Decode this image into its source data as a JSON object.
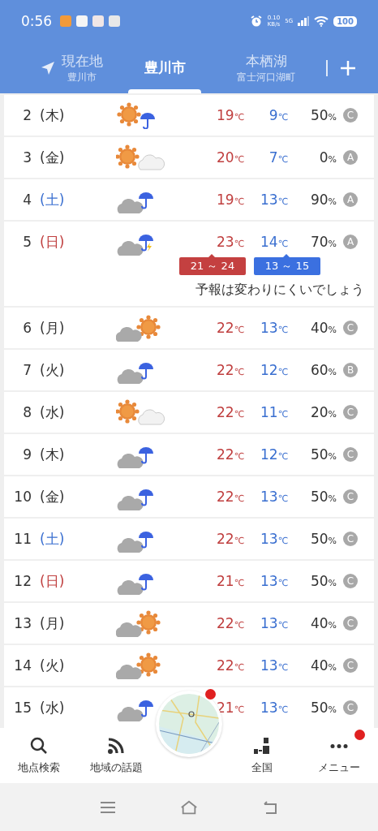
{
  "status_bar": {
    "time": "0:56",
    "net_speed": "0.10",
    "net_unit": "KB/s",
    "network": "5G",
    "battery": "100"
  },
  "tabs": [
    {
      "kind": "location",
      "label": "現在地",
      "sublabel": "豊川市",
      "selected": false
    },
    {
      "kind": "place",
      "label": "豊川市",
      "selected": true
    },
    {
      "kind": "place",
      "label": "本栖湖",
      "sublabel": "富士河口湖町",
      "selected": false
    }
  ],
  "days": [
    {
      "date": "2",
      "weekday": "(木)",
      "color": "#333333",
      "kind": "sun-rain",
      "high": "19",
      "low": "9",
      "unit": "℃",
      "pop": "50",
      "pop_unit": "%",
      "rank": "C"
    },
    {
      "date": "3",
      "weekday": "(金)",
      "color": "#333333",
      "kind": "sun-cloud",
      "high": "20",
      "low": "7",
      "unit": "℃",
      "pop": "0",
      "pop_unit": "%",
      "rank": "A"
    },
    {
      "date": "4",
      "weekday": "(土)",
      "color": "#3a6fd0",
      "kind": "cloud-rain",
      "high": "19",
      "low": "13",
      "unit": "℃",
      "pop": "90",
      "pop_unit": "%",
      "rank": "A"
    },
    {
      "date": "5",
      "weekday": "(日)",
      "color": "#c04040",
      "kind": "cloud-thunder-rain",
      "high": "23",
      "low": "14",
      "unit": "℃",
      "pop": "70",
      "pop_unit": "%",
      "rank": "A",
      "high_range": "21 ～ 24",
      "low_range": "13 ～ 15",
      "note": "予報は変わりにくいでしょう"
    },
    {
      "date": "6",
      "weekday": "(月)",
      "color": "#333333",
      "kind": "cloud-sun",
      "high": "22",
      "low": "13",
      "unit": "℃",
      "pop": "40",
      "pop_unit": "%",
      "rank": "C"
    },
    {
      "date": "7",
      "weekday": "(火)",
      "color": "#333333",
      "kind": "cloud-rain",
      "high": "22",
      "low": "12",
      "unit": "℃",
      "pop": "60",
      "pop_unit": "%",
      "rank": "B"
    },
    {
      "date": "8",
      "weekday": "(水)",
      "color": "#333333",
      "kind": "sun-cloud",
      "high": "22",
      "low": "11",
      "unit": "℃",
      "pop": "20",
      "pop_unit": "%",
      "rank": "C"
    },
    {
      "date": "9",
      "weekday": "(木)",
      "color": "#333333",
      "kind": "cloud-rain",
      "high": "22",
      "low": "12",
      "unit": "℃",
      "pop": "50",
      "pop_unit": "%",
      "rank": "C"
    },
    {
      "date": "10",
      "weekday": "(金)",
      "color": "#333333",
      "kind": "cloud-rain",
      "high": "22",
      "low": "13",
      "unit": "℃",
      "pop": "50",
      "pop_unit": "%",
      "rank": "C"
    },
    {
      "date": "11",
      "weekday": "(土)",
      "color": "#3a6fd0",
      "kind": "cloud-rain",
      "high": "22",
      "low": "13",
      "unit": "℃",
      "pop": "50",
      "pop_unit": "%",
      "rank": "C"
    },
    {
      "date": "12",
      "weekday": "(日)",
      "color": "#c04040",
      "kind": "cloud-rain",
      "high": "21",
      "low": "13",
      "unit": "℃",
      "pop": "50",
      "pop_unit": "%",
      "rank": "C"
    },
    {
      "date": "13",
      "weekday": "(月)",
      "color": "#333333",
      "kind": "cloud-sun",
      "high": "22",
      "low": "13",
      "unit": "℃",
      "pop": "40",
      "pop_unit": "%",
      "rank": "C"
    },
    {
      "date": "14",
      "weekday": "(火)",
      "color": "#333333",
      "kind": "cloud-sun",
      "high": "22",
      "low": "13",
      "unit": "℃",
      "pop": "40",
      "pop_unit": "%",
      "rank": "C"
    },
    {
      "date": "15",
      "weekday": "(水)",
      "color": "#333333",
      "kind": "cloud-rain",
      "high": "21",
      "low": "13",
      "unit": "℃",
      "pop": "50",
      "pop_unit": "%",
      "rank": "C"
    }
  ],
  "bottom_nav": [
    {
      "kind": "search",
      "label": "地点検索",
      "badge": false
    },
    {
      "kind": "feed",
      "label": "地域の話題",
      "badge": false
    },
    {
      "kind": "map",
      "badge": true
    },
    {
      "kind": "bars",
      "label": "全国",
      "badge": false
    },
    {
      "kind": "more",
      "label": "メニュー",
      "badge": true
    }
  ]
}
